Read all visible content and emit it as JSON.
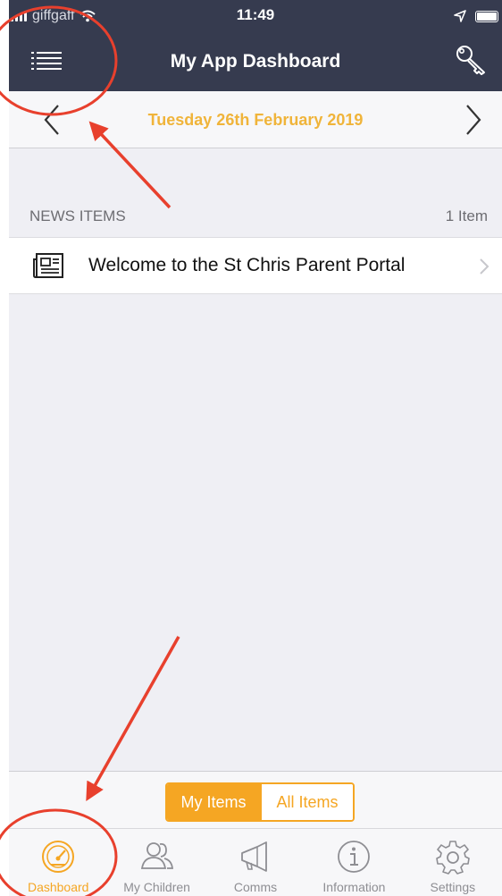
{
  "status_bar": {
    "carrier": "giffgaff",
    "time": "11:49"
  },
  "nav": {
    "title": "My App Dashboard",
    "menu_icon": "hamburger-menu-icon",
    "key_icon": "key-icon"
  },
  "date_bar": {
    "date": "Tuesday 26th February 2019",
    "prev_icon": "chevron-left-icon",
    "next_icon": "chevron-right-icon"
  },
  "news": {
    "section_title": "NEWS ITEMS",
    "count": "1 Item",
    "items": [
      {
        "label": "Welcome to the St Chris Parent Portal",
        "icon": "newspaper-icon"
      }
    ]
  },
  "segment": {
    "my_items": "My Items",
    "all_items": "All Items",
    "selected": "My Items"
  },
  "tabs": [
    {
      "label": "Dashboard",
      "icon": "speedometer-icon",
      "active": true
    },
    {
      "label": "My Children",
      "icon": "people-icon",
      "active": false
    },
    {
      "label": "Comms",
      "icon": "megaphone-icon",
      "active": false
    },
    {
      "label": "Information",
      "icon": "info-icon",
      "active": false
    },
    {
      "label": "Settings",
      "icon": "gear-icon",
      "active": false
    }
  ],
  "colors": {
    "header_bg": "#363b4f",
    "accent": "#f5a623",
    "date_text": "#f0b43a",
    "annotation": "#e8402d"
  }
}
